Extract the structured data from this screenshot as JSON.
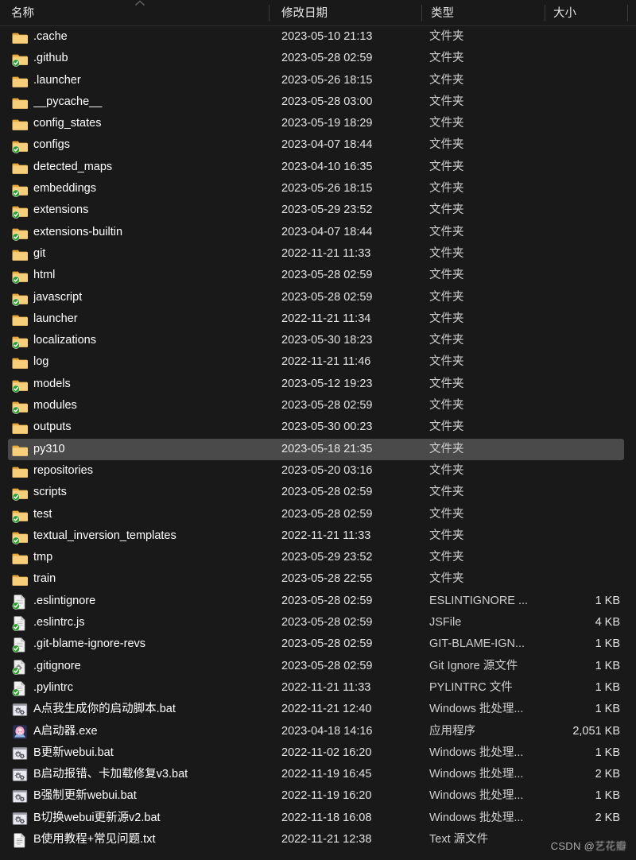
{
  "window": {
    "app": "Windows File Explorer",
    "theme_background": "#191919",
    "selection_color": "#4a4a4a",
    "folder_icon_color": "#f5c066",
    "overlay_check_color": "#2fa12f"
  },
  "columns": {
    "name": "名称",
    "date_modified": "修改日期",
    "type": "类型",
    "size": "大小",
    "sort_icon": "chevron-up-icon",
    "sorted_by": "名称",
    "sort_direction": "ascending"
  },
  "files": [
    {
      "name": ".cache",
      "date": "2023-05-10 21:13",
      "type": "文件夹",
      "size": "",
      "icon": "folder-icon",
      "overlay": false
    },
    {
      "name": ".github",
      "date": "2023-05-28 02:59",
      "type": "文件夹",
      "size": "",
      "icon": "folder-icon",
      "overlay": true
    },
    {
      "name": ".launcher",
      "date": "2023-05-26 18:15",
      "type": "文件夹",
      "size": "",
      "icon": "folder-icon",
      "overlay": false
    },
    {
      "name": "__pycache__",
      "date": "2023-05-28 03:00",
      "type": "文件夹",
      "size": "",
      "icon": "folder-icon",
      "overlay": false
    },
    {
      "name": "config_states",
      "date": "2023-05-19 18:29",
      "type": "文件夹",
      "size": "",
      "icon": "folder-icon",
      "overlay": false
    },
    {
      "name": "configs",
      "date": "2023-04-07 18:44",
      "type": "文件夹",
      "size": "",
      "icon": "folder-icon",
      "overlay": true
    },
    {
      "name": "detected_maps",
      "date": "2023-04-10 16:35",
      "type": "文件夹",
      "size": "",
      "icon": "folder-icon",
      "overlay": false
    },
    {
      "name": "embeddings",
      "date": "2023-05-26 18:15",
      "type": "文件夹",
      "size": "",
      "icon": "folder-icon",
      "overlay": true
    },
    {
      "name": "extensions",
      "date": "2023-05-29 23:52",
      "type": "文件夹",
      "size": "",
      "icon": "folder-icon",
      "overlay": true
    },
    {
      "name": "extensions-builtin",
      "date": "2023-04-07 18:44",
      "type": "文件夹",
      "size": "",
      "icon": "folder-icon",
      "overlay": true
    },
    {
      "name": "git",
      "date": "2022-11-21 11:33",
      "type": "文件夹",
      "size": "",
      "icon": "folder-icon",
      "overlay": false
    },
    {
      "name": "html",
      "date": "2023-05-28 02:59",
      "type": "文件夹",
      "size": "",
      "icon": "folder-icon",
      "overlay": true
    },
    {
      "name": "javascript",
      "date": "2023-05-28 02:59",
      "type": "文件夹",
      "size": "",
      "icon": "folder-icon",
      "overlay": true
    },
    {
      "name": "launcher",
      "date": "2022-11-21 11:34",
      "type": "文件夹",
      "size": "",
      "icon": "folder-icon",
      "overlay": false
    },
    {
      "name": "localizations",
      "date": "2023-05-30 18:23",
      "type": "文件夹",
      "size": "",
      "icon": "folder-icon",
      "overlay": true
    },
    {
      "name": "log",
      "date": "2022-11-21 11:46",
      "type": "文件夹",
      "size": "",
      "icon": "folder-icon",
      "overlay": false
    },
    {
      "name": "models",
      "date": "2023-05-12 19:23",
      "type": "文件夹",
      "size": "",
      "icon": "folder-icon",
      "overlay": true
    },
    {
      "name": "modules",
      "date": "2023-05-28 02:59",
      "type": "文件夹",
      "size": "",
      "icon": "folder-icon",
      "overlay": true
    },
    {
      "name": "outputs",
      "date": "2023-05-30 00:23",
      "type": "文件夹",
      "size": "",
      "icon": "folder-icon",
      "overlay": false
    },
    {
      "name": "py310",
      "date": "2023-05-18 21:35",
      "type": "文件夹",
      "size": "",
      "icon": "folder-icon",
      "overlay": false,
      "selected": true
    },
    {
      "name": "repositories",
      "date": "2023-05-20 03:16",
      "type": "文件夹",
      "size": "",
      "icon": "folder-icon",
      "overlay": false
    },
    {
      "name": "scripts",
      "date": "2023-05-28 02:59",
      "type": "文件夹",
      "size": "",
      "icon": "folder-icon",
      "overlay": true
    },
    {
      "name": "test",
      "date": "2023-05-28 02:59",
      "type": "文件夹",
      "size": "",
      "icon": "folder-icon",
      "overlay": true
    },
    {
      "name": "textual_inversion_templates",
      "date": "2022-11-21 11:33",
      "type": "文件夹",
      "size": "",
      "icon": "folder-icon",
      "overlay": true
    },
    {
      "name": "tmp",
      "date": "2023-05-29 23:52",
      "type": "文件夹",
      "size": "",
      "icon": "folder-icon",
      "overlay": false
    },
    {
      "name": "train",
      "date": "2023-05-28 22:55",
      "type": "文件夹",
      "size": "",
      "icon": "folder-icon",
      "overlay": false
    },
    {
      "name": ".eslintignore",
      "date": "2023-05-28 02:59",
      "type": "ESLINTIGNORE ...",
      "size": "1 KB",
      "icon": "document-icon",
      "overlay": true
    },
    {
      "name": ".eslintrc.js",
      "date": "2023-05-28 02:59",
      "type": "JSFile",
      "size": "4 KB",
      "icon": "document-icon",
      "overlay": true
    },
    {
      "name": ".git-blame-ignore-revs",
      "date": "2023-05-28 02:59",
      "type": "GIT-BLAME-IGN...",
      "size": "1 KB",
      "icon": "document-icon",
      "overlay": true
    },
    {
      "name": ".gitignore",
      "date": "2023-05-28 02:59",
      "type": "Git Ignore 源文件",
      "size": "1 KB",
      "icon": "gitignore-icon",
      "overlay": true
    },
    {
      "name": ".pylintrc",
      "date": "2022-11-21 11:33",
      "type": "PYLINTRC 文件",
      "size": "1 KB",
      "icon": "document-icon",
      "overlay": true
    },
    {
      "name": "A点我生成你的启动脚本.bat",
      "date": "2022-11-21 12:40",
      "type": "Windows 批处理...",
      "size": "1 KB",
      "icon": "batch-gear-icon",
      "overlay": false
    },
    {
      "name": "A启动器.exe",
      "date": "2023-04-18 14:16",
      "type": "应用程序",
      "size": "2,051 KB",
      "icon": "app-avatar-icon",
      "overlay": false
    },
    {
      "name": "B更新webui.bat",
      "date": "2022-11-02 16:20",
      "type": "Windows 批处理...",
      "size": "1 KB",
      "icon": "batch-gear-icon",
      "overlay": false
    },
    {
      "name": "B启动报错、卡加载修复v3.bat",
      "date": "2022-11-19 16:45",
      "type": "Windows 批处理...",
      "size": "2 KB",
      "icon": "batch-gear-icon",
      "overlay": false
    },
    {
      "name": "B强制更新webui.bat",
      "date": "2022-11-19 16:20",
      "type": "Windows 批处理...",
      "size": "1 KB",
      "icon": "batch-gear-icon",
      "overlay": false
    },
    {
      "name": "B切换webui更新源v2.bat",
      "date": "2022-11-18 16:08",
      "type": "Windows 批处理...",
      "size": "2 KB",
      "icon": "batch-gear-icon",
      "overlay": false
    },
    {
      "name": "B使用教程+常见问题.txt",
      "date": "2022-11-21 12:38",
      "type": "Text 源文件",
      "size": "",
      "icon": "text-file-icon",
      "overlay": false
    }
  ],
  "watermark": {
    "prefix": "CSDN @",
    "handle": "艺花瓣"
  }
}
